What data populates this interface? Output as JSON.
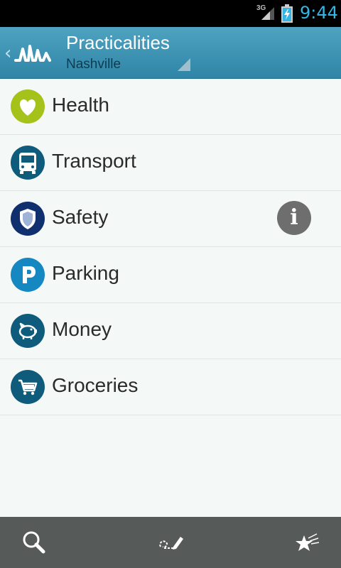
{
  "status_bar": {
    "network": "3G",
    "time": "9:44"
  },
  "header": {
    "title": "Practicalities",
    "subtitle": "Nashville"
  },
  "items": [
    {
      "label": "Health",
      "icon": "heart-icon",
      "color": "#a4c21a"
    },
    {
      "label": "Transport",
      "icon": "bus-icon",
      "color": "#0f5b7b"
    },
    {
      "label": "Safety",
      "icon": "shield-icon",
      "color": "#0f2f6e"
    },
    {
      "label": "Parking",
      "icon": "parking-icon",
      "color": "#1587c1"
    },
    {
      "label": "Money",
      "icon": "piggy-bank-icon",
      "color": "#0f5b7b"
    },
    {
      "label": "Groceries",
      "icon": "shopping-cart-icon",
      "color": "#0f5b7b"
    }
  ],
  "info_glyph": "i",
  "bottom_bar": {
    "buttons": [
      "search-icon",
      "write-icon",
      "favorites-icon"
    ]
  },
  "colors": {
    "header": "#3b93b5",
    "bottom_bar": "#565a59",
    "status_time": "#33b5e5"
  }
}
